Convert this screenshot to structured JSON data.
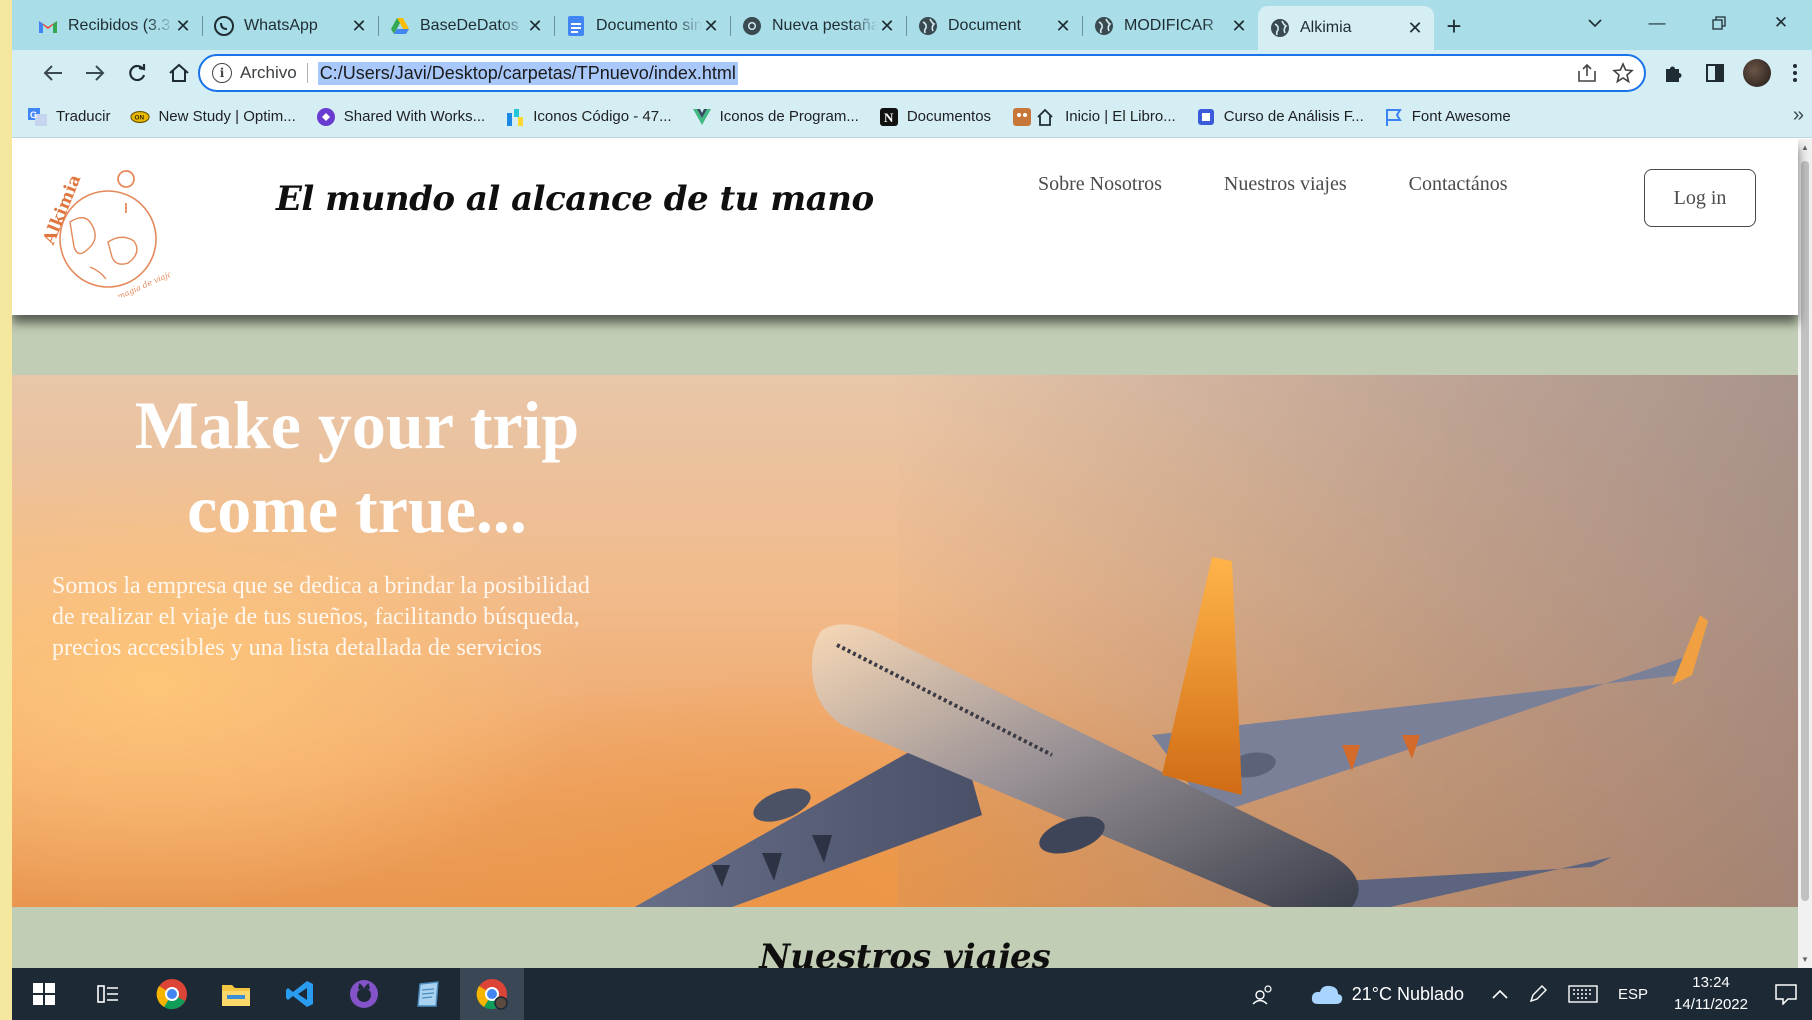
{
  "browser": {
    "tabs": [
      {
        "title": "Recibidos (3.3",
        "icon": "gmail-icon",
        "active": false
      },
      {
        "title": "WhatsApp",
        "icon": "whatsapp-icon",
        "active": false
      },
      {
        "title": "BaseDeDatos",
        "icon": "google-drive-icon",
        "active": false
      },
      {
        "title": "Documento sin",
        "icon": "google-docs-icon",
        "active": false
      },
      {
        "title": "Nueva pestaña",
        "icon": "chrome-icon",
        "active": false
      },
      {
        "title": "Document",
        "icon": "globe-icon",
        "active": false
      },
      {
        "title": "MODIFICAR",
        "icon": "globe-icon",
        "active": false
      },
      {
        "title": "Alkimia",
        "icon": "globe-icon",
        "active": true
      }
    ],
    "address": {
      "scheme_label": "Archivo",
      "url": "C:/Users/Javi/Desktop/carpetas/TPnuevo/index.html"
    },
    "bookmarks": [
      {
        "label": "Traducir",
        "icon": "translate-icon"
      },
      {
        "label": "New Study | Optim...",
        "icon": "newstudy-icon"
      },
      {
        "label": "Shared With Works...",
        "icon": "workspace-icon"
      },
      {
        "label": "Iconos Código - 47...",
        "icon": "iconos-icon"
      },
      {
        "label": "Iconos de Program...",
        "icon": "vue-icon"
      },
      {
        "label": "Documentos",
        "icon": "notion-icon"
      },
      {
        "label": "Inicio | El Libro...",
        "icon": "home-icon"
      },
      {
        "label": "Curso de Análisis F...",
        "icon": "course-icon"
      },
      {
        "label": "Font Awesome",
        "icon": "flag-icon"
      }
    ]
  },
  "site": {
    "logo_text": "Alkimia",
    "logo_subtext": "La magia de viajar",
    "tagline": "El mundo al alcance de tu mano",
    "nav": [
      "Sobre Nosotros",
      "Nuestros viajes",
      "Contactános"
    ],
    "login_label": "Log in",
    "hero": {
      "title_line1": "Make your trip",
      "title_line2": "come true...",
      "text": "Somos la empresa que se dedica a brindar la posibilidad de realizar el viaje de tus sueños, facilitando búsqueda, precios accesibles y una lista detallada de servicios"
    },
    "section_title": "Nuestros viajes"
  },
  "taskbar": {
    "weather": "21°C  Nublado",
    "language": "ESP",
    "time": "13:24",
    "date": "14/11/2022"
  }
}
